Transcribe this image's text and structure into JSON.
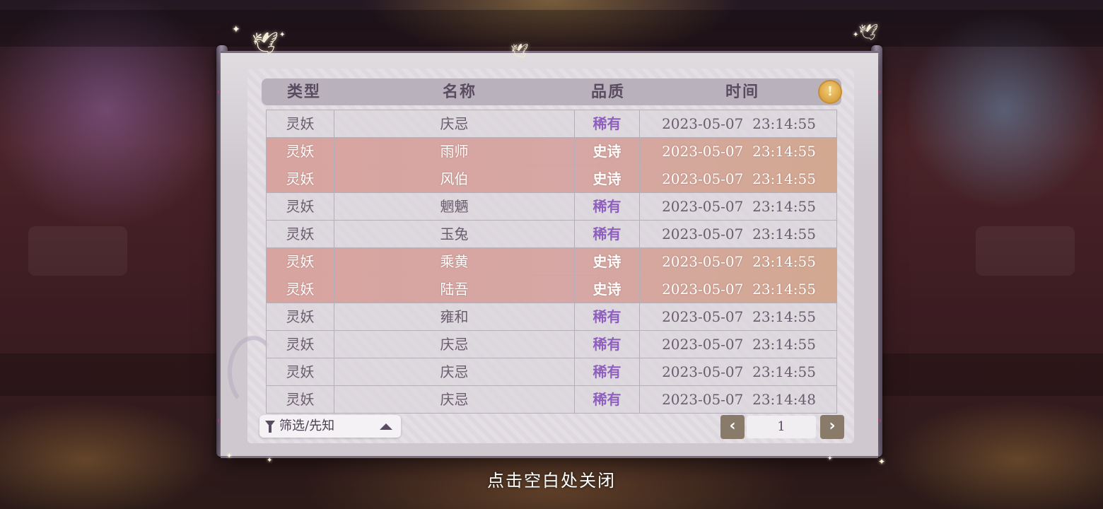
{
  "header": {
    "columns": [
      "类型",
      "名称",
      "品质",
      "时间"
    ]
  },
  "rows": [
    {
      "type": "灵妖",
      "name": "庆忌",
      "quality": "稀有",
      "time": "2023-05-07  23:14:55",
      "tier": "rare"
    },
    {
      "type": "灵妖",
      "name": "雨师",
      "quality": "史诗",
      "time": "2023-05-07  23:14:55",
      "tier": "epic"
    },
    {
      "type": "灵妖",
      "name": "风伯",
      "quality": "史诗",
      "time": "2023-05-07  23:14:55",
      "tier": "epic"
    },
    {
      "type": "灵妖",
      "name": "魍魉",
      "quality": "稀有",
      "time": "2023-05-07  23:14:55",
      "tier": "rare"
    },
    {
      "type": "灵妖",
      "name": "玉兔",
      "quality": "稀有",
      "time": "2023-05-07  23:14:55",
      "tier": "rare"
    },
    {
      "type": "灵妖",
      "name": "乘黄",
      "quality": "史诗",
      "time": "2023-05-07  23:14:55",
      "tier": "epic"
    },
    {
      "type": "灵妖",
      "name": "陆吾",
      "quality": "史诗",
      "time": "2023-05-07  23:14:55",
      "tier": "epic"
    },
    {
      "type": "灵妖",
      "name": "雍和",
      "quality": "稀有",
      "time": "2023-05-07  23:14:55",
      "tier": "rare"
    },
    {
      "type": "灵妖",
      "name": "庆忌",
      "quality": "稀有",
      "time": "2023-05-07  23:14:55",
      "tier": "rare"
    },
    {
      "type": "灵妖",
      "name": "庆忌",
      "quality": "稀有",
      "time": "2023-05-07  23:14:55",
      "tier": "rare"
    },
    {
      "type": "灵妖",
      "name": "庆忌",
      "quality": "稀有",
      "time": "2023-05-07  23:14:48",
      "tier": "rare"
    }
  ],
  "footer": {
    "filter_label": "筛选/先知",
    "page_number": "1",
    "prev_glyph": "‹",
    "next_glyph": "›"
  },
  "hint_icon_glyph": "!",
  "close_hint": "点击空白处关闭",
  "colors": {
    "rare_quality": "#8f5fc0",
    "epic_row": "#d6a7a4",
    "scroll_paper": "#e2dde2"
  },
  "icons": [
    "hint-icon",
    "filter-icon",
    "chevron-up-icon",
    "chevron-left-icon",
    "chevron-right-icon",
    "swallow-icon",
    "sparkle-icon"
  ]
}
